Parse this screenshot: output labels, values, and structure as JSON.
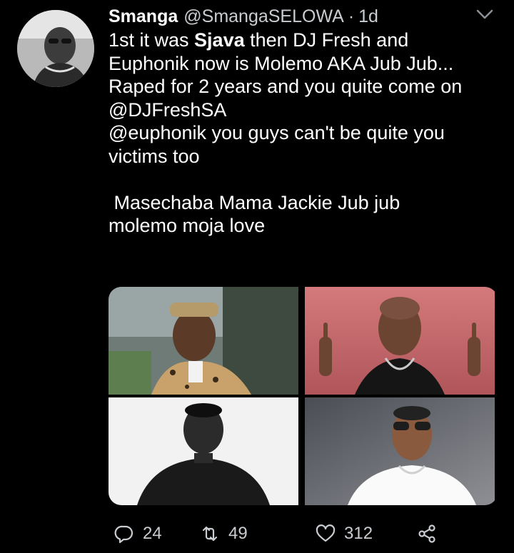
{
  "tweet": {
    "display_name": "Smanga",
    "handle": "@SmangaSELOWA",
    "separator": "·",
    "time": "1d",
    "text": {
      "line1_prefix": "1st it was ",
      "line1_bold": "Sjava",
      "line1_suffix": " then DJ Fresh and",
      "line2": "Euphonik now is Molemo AKA Jub Jub...",
      "line3": "Raped for 2 years and you quite come on",
      "mention1": "@DJFreshSA",
      "mention2": "@euphonik",
      "line5_suffix": " you guys can't be quite you",
      "line6": "victims too",
      "line7": " Masechaba Mama Jackie Jub jub",
      "line8": "molemo moja love"
    },
    "stats": {
      "replies": "24",
      "retweets": "49",
      "likes": "312"
    }
  },
  "icons": {
    "caret": "chevron-down-icon",
    "reply": "reply-icon",
    "retweet": "retweet-icon",
    "like": "heart-icon",
    "share": "share-icon"
  },
  "colors": {
    "background": "#000000",
    "text": "#ffffff",
    "muted": "#c9cdd1"
  }
}
